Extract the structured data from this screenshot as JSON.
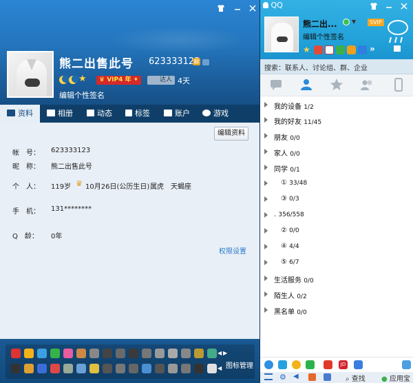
{
  "profile": {
    "name": "熊二出售此号",
    "qq_number": "623333123",
    "vip": "VIP4 年",
    "daren_label": "达人",
    "daren_days": "4天",
    "signature": "编辑个性签名",
    "tabs": [
      {
        "label": "资料",
        "icon": "card-icon"
      },
      {
        "label": "相册",
        "icon": "photo-icon"
      },
      {
        "label": "动态",
        "icon": "feed-icon"
      },
      {
        "label": "标签",
        "icon": "tag-icon"
      },
      {
        "label": "账户",
        "icon": "wallet-icon"
      },
      {
        "label": "游戏",
        "icon": "game-icon"
      }
    ],
    "edit_button": "编辑资料",
    "fields": {
      "account_label": "帐　号：",
      "account_value": "623333123",
      "nick_label": "昵　称：",
      "nick_value": "熊二出售此号",
      "person_label": "个　人：",
      "age": "119岁",
      "birthday": "10月26日(公历生日)",
      "zodiac": "属虎",
      "constellation": "天蝎座",
      "phone_label": "手　机：",
      "phone_value": "131********",
      "qage_label": "Q　龄：",
      "qage_value": "0年"
    },
    "permission_link": "权限设置",
    "icon_manage": "图标管理"
  },
  "main": {
    "window_title": "QQ",
    "name": "熊二出...",
    "svip": "SVIP",
    "signature": "编辑个性签名",
    "search_placeholder": "搜索：联系人、讨论组、群、企业",
    "groups": [
      {
        "name": "我的设备",
        "count": "1/2"
      },
      {
        "name": "我的好友",
        "count": "11/45"
      },
      {
        "name": "朋友",
        "count": "0/0"
      },
      {
        "name": "家人",
        "count": "0/0"
      },
      {
        "name": "同学",
        "count": "0/1"
      },
      {
        "name": "①",
        "count": "33/48"
      },
      {
        "name": "③",
        "count": "0/3"
      },
      {
        "name": ".",
        "count": "356/558"
      },
      {
        "name": "②",
        "count": "0/0"
      },
      {
        "name": "④",
        "count": "4/4"
      },
      {
        "name": "⑤",
        "count": "6/7"
      },
      {
        "name": "生活服务",
        "count": "0/0"
      },
      {
        "name": "陌生人",
        "count": "0/2"
      },
      {
        "name": "黑名单",
        "count": "0/0"
      }
    ],
    "bottom_search": "查找",
    "bottom_app": "应用宝"
  },
  "colors": {
    "profile_top": "#2374bb",
    "profile_tabs": "#0f3f69",
    "main_top": "#22a1d9",
    "link": "#2a7cd2"
  }
}
